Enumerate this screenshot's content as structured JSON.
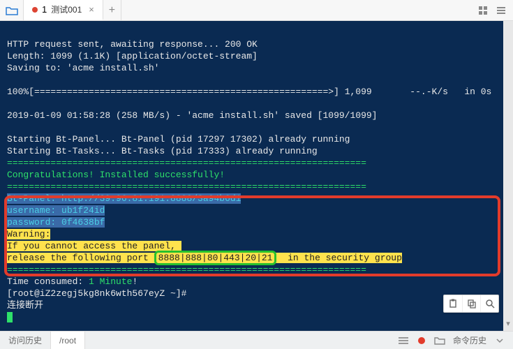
{
  "tab": {
    "number": "1",
    "title": "测试001",
    "close": "×",
    "add": "+"
  },
  "term": {
    "l1": "HTTP request sent, awaiting response... 200 OK",
    "l2": "Length: 1099 (1.1K) [application/octet-stream]",
    "l3": "Saving to: 'acme install.sh'",
    "l4a": "100%[",
    "l4b": "======================================================>",
    "l4c": "] 1,099       --.-K/s   in 0s",
    "l5": "2019-01-09 01:58:28 (258 MB/s) - 'acme install.sh' saved [1099/1099]",
    "l6": "Starting Bt-Panel... Bt-Panel (pid 17297 17302) already running",
    "l7": "Starting Bt-Tasks... Bt-Tasks (pid 17333) already running",
    "sep": "==================================================================",
    "congrats": "Congratulations! Installed successfully!",
    "panel_line_a": "Bt-Panel: ",
    "panel_url": "http://39.96.81.191:8888/3a94b6d1",
    "user_line": "username: ub1f24id",
    "pass_line": "password: 0f4638bf",
    "warn_label": "Warning:",
    "warn1": "If you cannot access the panel, ",
    "warn2a": "release the following port ",
    "ports": "8888|888|80|443|20|21",
    "warn2b": "  in the security group",
    "time_a": "Time consumed: ",
    "time_b": "1 Minute",
    "time_c": "!",
    "prompt": "[root@iZ2zegj5kg8nk6wth567eyZ ~]#",
    "disc": "连接断开"
  },
  "footer": {
    "history": "访问历史",
    "path": "/root",
    "cmd": "命令历史"
  }
}
